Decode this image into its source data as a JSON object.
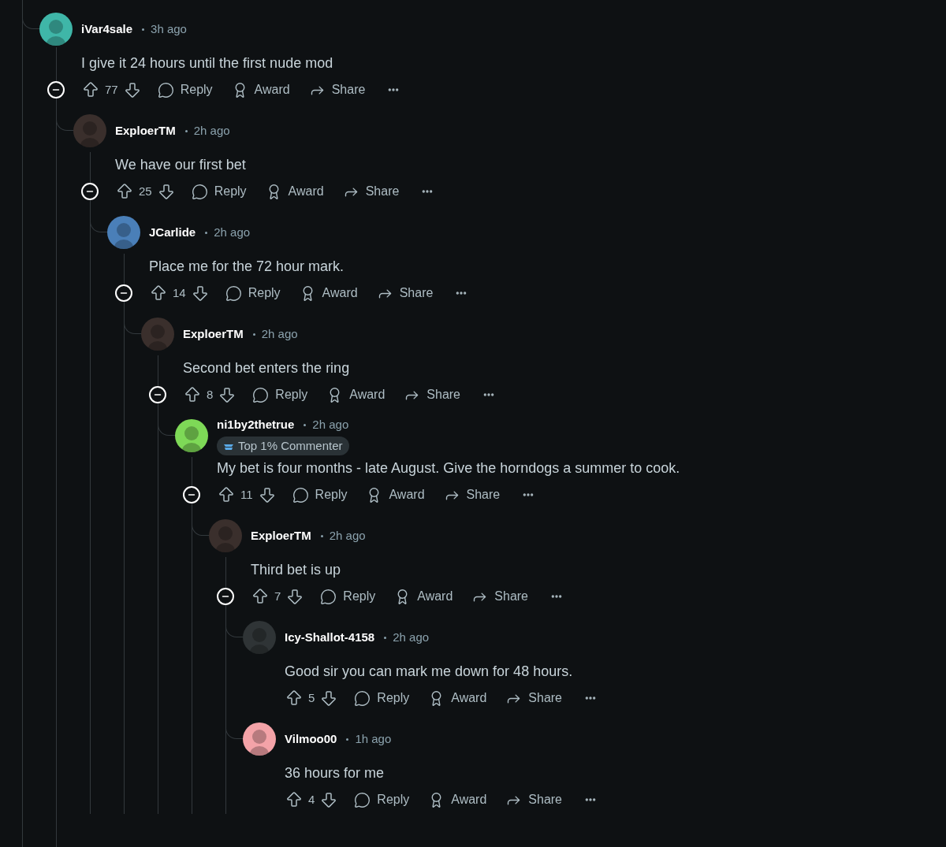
{
  "comments": [
    {
      "author": "iVar4sale",
      "time": "3h ago",
      "body": "I give it 24 hours until the first nude mod",
      "votes": "77",
      "color": "#3fb6a8",
      "expanded": true,
      "actions": [
        "Reply",
        "Award",
        "Share"
      ],
      "children": [
        {
          "author": "ExploerTM",
          "time": "2h ago",
          "body": "We have our first bet",
          "votes": "25",
          "color": "#3a2f2c",
          "expanded": true,
          "actions": [
            "Reply",
            "Award",
            "Share"
          ],
          "children": [
            {
              "author": "JCarlide",
              "time": "2h ago",
              "body": "Place me for the 72 hour mark.",
              "votes": "14",
              "color": "#4a7fb8",
              "expanded": true,
              "actions": [
                "Reply",
                "Award",
                "Share"
              ],
              "children": [
                {
                  "author": "ExploerTM",
                  "time": "2h ago",
                  "body": "Second bet enters the ring",
                  "votes": "8",
                  "color": "#3a2f2c",
                  "expanded": true,
                  "actions": [
                    "Reply",
                    "Award",
                    "Share"
                  ],
                  "children": [
                    {
                      "author": "ni1by2thetrue",
                      "time": "2h ago",
                      "flair": "Top 1% Commenter",
                      "body": "My bet is four months - late August. Give the horndogs a summer to cook.",
                      "votes": "11",
                      "color": "#7ed957",
                      "expanded": true,
                      "actions": [
                        "Reply",
                        "Award",
                        "Share"
                      ],
                      "children": [
                        {
                          "author": "ExploerTM",
                          "time": "2h ago",
                          "body": "Third bet is up",
                          "votes": "7",
                          "color": "#3a2f2c",
                          "expanded": true,
                          "actions": [
                            "Reply",
                            "Award",
                            "Share"
                          ],
                          "children": [
                            {
                              "author": "Icy-Shallot-4158",
                              "time": "2h ago",
                              "body": "Good sir you can mark me down for 48 hours.",
                              "votes": "5",
                              "color": "#2f3436",
                              "actions": [
                                "Reply",
                                "Award",
                                "Share"
                              ]
                            },
                            {
                              "author": "Vilmoo00",
                              "time": "1h ago",
                              "body": "36 hours for me",
                              "votes": "4",
                              "color": "#f4a3a8",
                              "actions": [
                                "Reply",
                                "Award",
                                "Share"
                              ]
                            }
                          ]
                        }
                      ]
                    }
                  ]
                }
              ]
            }
          ]
        }
      ]
    }
  ]
}
